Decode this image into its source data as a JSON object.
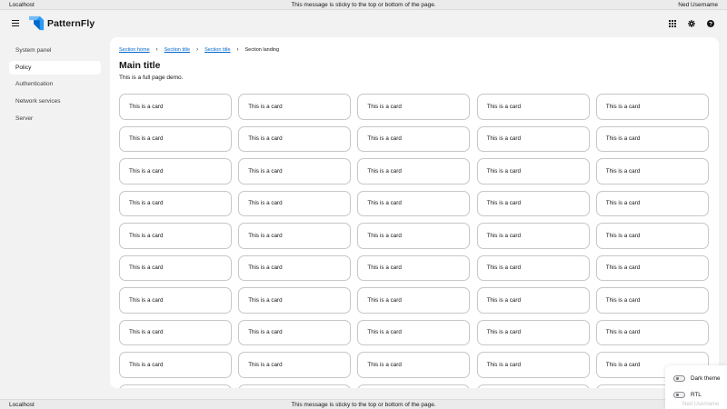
{
  "top_banner": {
    "left": "Localhost",
    "center": "This message is sticky to the top or bottom of the page.",
    "right": "Ned Username"
  },
  "bottom_banner": {
    "left": "Localhost",
    "center": "This message is sticky to the top or bottom of the page."
  },
  "masthead": {
    "brand": "PatternFly",
    "brand_colors": {
      "light": "#73bcf7",
      "mid": "#2b9af3",
      "dark": "#06c"
    },
    "tools": [
      "grid-icon",
      "gear-icon",
      "help-icon"
    ]
  },
  "sidebar": {
    "items": [
      {
        "label": "System panel",
        "active": false
      },
      {
        "label": "Policy",
        "active": true
      },
      {
        "label": "Authentication",
        "active": false
      },
      {
        "label": "Network services",
        "active": false
      },
      {
        "label": "Server",
        "active": false
      }
    ]
  },
  "breadcrumb": {
    "items": [
      "Section home",
      "Section title",
      "Section title"
    ],
    "current": "Section landing"
  },
  "page": {
    "title": "Main title",
    "description": "This is a full page demo."
  },
  "cards": {
    "label": "This is a card"
  },
  "theme_panel": {
    "dark_theme": "Dark theme",
    "rtl": "RTL",
    "ghost_user": "Ned Username"
  },
  "colors": {
    "link": "#0066cc",
    "page_bg": "#f2f2f2",
    "card_border": "#c7c7c7"
  }
}
